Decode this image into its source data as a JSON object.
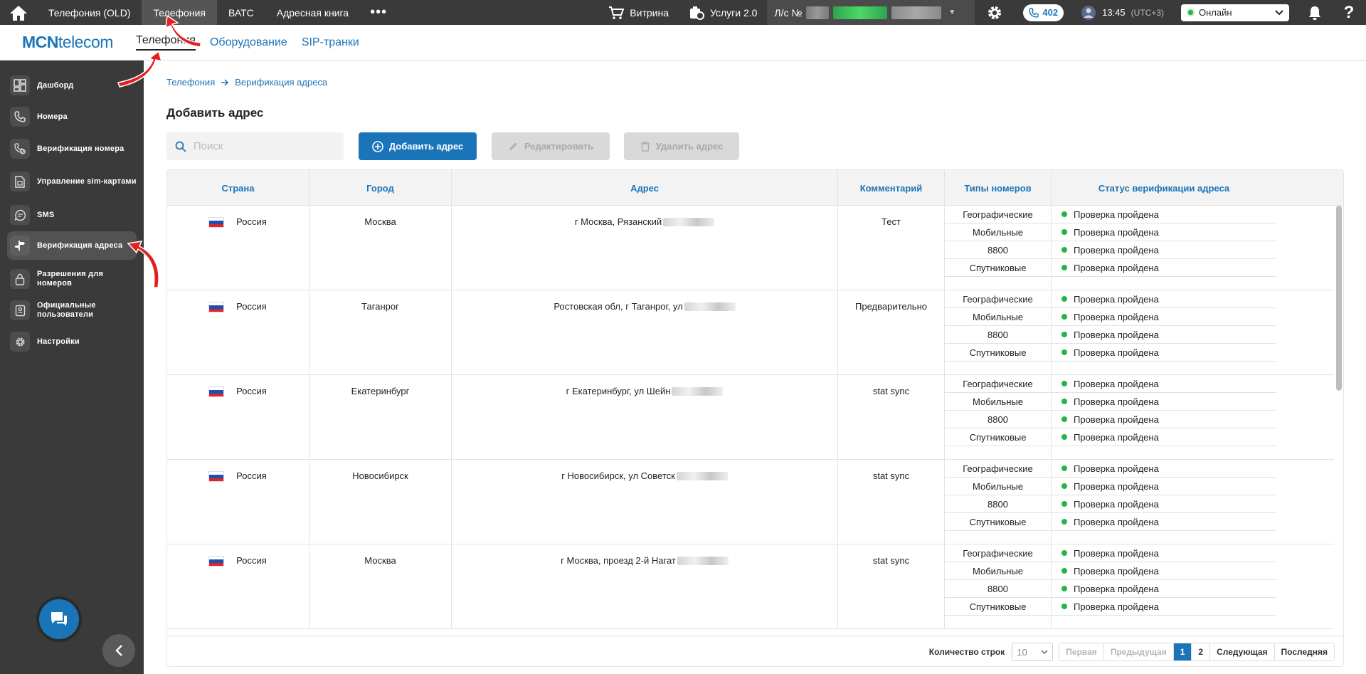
{
  "topbar": {
    "tabs": [
      {
        "label": "Телефония (OLD)",
        "active": false
      },
      {
        "label": "Телефония",
        "active": true
      },
      {
        "label": "ВАТС",
        "active": false
      },
      {
        "label": "Адресная книга",
        "active": false
      }
    ],
    "more": "•••",
    "showcase_label": "Витрина",
    "services_label": "Услуги 2.0",
    "account_label": "Л/с №",
    "calls_count": "402",
    "time": "13:45",
    "timezone": "(UTC+3)",
    "status": "Онлайн",
    "help": "?"
  },
  "subheader": {
    "logo_mcn": "MCN",
    "logo_telecom": "telecom",
    "tabs": [
      {
        "label": "Телефония",
        "active": true
      },
      {
        "label": "Оборудование",
        "active": false
      },
      {
        "label": "SIP-транки",
        "active": false
      }
    ]
  },
  "sidebar": {
    "items": [
      {
        "label": "Дашборд",
        "icon": "dashboard-icon"
      },
      {
        "label": "Номера",
        "icon": "phone-icon"
      },
      {
        "label": "Верификация номера",
        "icon": "phone-check-icon"
      },
      {
        "label": "Управление sim-картами",
        "icon": "sim-card-icon"
      },
      {
        "label": "SMS",
        "icon": "sms-icon"
      },
      {
        "label": "Верификация адреса",
        "icon": "signpost-icon",
        "active": true
      },
      {
        "label": "Разрешения для номеров",
        "icon": "lock-icon"
      },
      {
        "label": "Официальные пользователи",
        "icon": "id-card-icon"
      },
      {
        "label": "Настройки",
        "icon": "gear-icon"
      }
    ]
  },
  "breadcrumb": {
    "root": "Телефония",
    "current": "Верификация адреса"
  },
  "page_title": "Добавить адрес",
  "search": {
    "placeholder": "Поиск",
    "value": ""
  },
  "actions": {
    "add": "Добавить адрес",
    "edit": "Редактировать",
    "delete": "Удалить адрес"
  },
  "table": {
    "columns": [
      "Страна",
      "Город",
      "Адрес",
      "Комментарий",
      "Типы номеров",
      "Статус верификации адреса"
    ],
    "rows": [
      {
        "country": "Россия",
        "city": "Москва",
        "address": "г Москва, Рязанский",
        "comment": "Тест"
      },
      {
        "country": "Россия",
        "city": "Таганрог",
        "address": "Ростовская обл, г Таганрог, ул",
        "comment": "Предварительно"
      },
      {
        "country": "Россия",
        "city": "Екатеринбург",
        "address": "г Екатеринбург, ул Шейн",
        "comment": "stat sync"
      },
      {
        "country": "Россия",
        "city": "Новосибирск",
        "address": "г Новосибирск, ул Советск",
        "comment": "stat sync"
      },
      {
        "country": "Россия",
        "city": "Москва",
        "address": "г Москва, проезд 2-й Нагат",
        "comment": "stat sync"
      }
    ],
    "number_types": [
      "Географические",
      "Мобильные",
      "8800",
      "Спутниковые"
    ],
    "status_text": "Проверка пройдена"
  },
  "footer": {
    "rows_label": "Количество строк",
    "rows_value": "10",
    "first": "Первая",
    "prev": "Предыдущая",
    "pages": [
      "1",
      "2"
    ],
    "current_page": "1",
    "next": "Следующая",
    "last": "Последняя"
  },
  "colors": {
    "accent": "#1a74b8",
    "sidebar": "#3a3a3a",
    "success": "#27b34a",
    "annotation": "#e32020"
  }
}
